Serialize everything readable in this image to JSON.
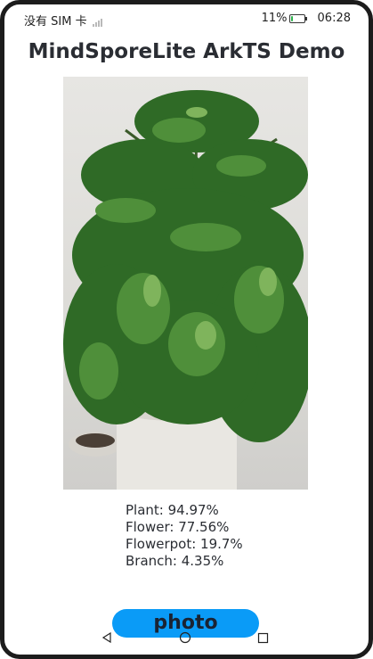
{
  "status_bar": {
    "carrier": "没有 SIM 卡",
    "battery_percent": "11%",
    "battery_level": 0.11,
    "time": "06:28",
    "icons": [
      "signal-icon",
      "battery-icon"
    ]
  },
  "header": {
    "title": "MindSporeLite ArkTS Demo"
  },
  "image": {
    "icon": "plant-photo"
  },
  "results": [
    {
      "text": "Plant: 94.97%"
    },
    {
      "text": "Flower: 77.56%"
    },
    {
      "text": "Flowerpot: 19.7%"
    },
    {
      "text": "Branch: 4.35%"
    }
  ],
  "button": {
    "label": "photo"
  },
  "nav": {
    "icons": [
      "back-icon",
      "home-icon",
      "recents-icon"
    ]
  },
  "colors": {
    "accent": "#0a9bf7",
    "title": "#2a2d33",
    "battery": "#2bb24c"
  }
}
